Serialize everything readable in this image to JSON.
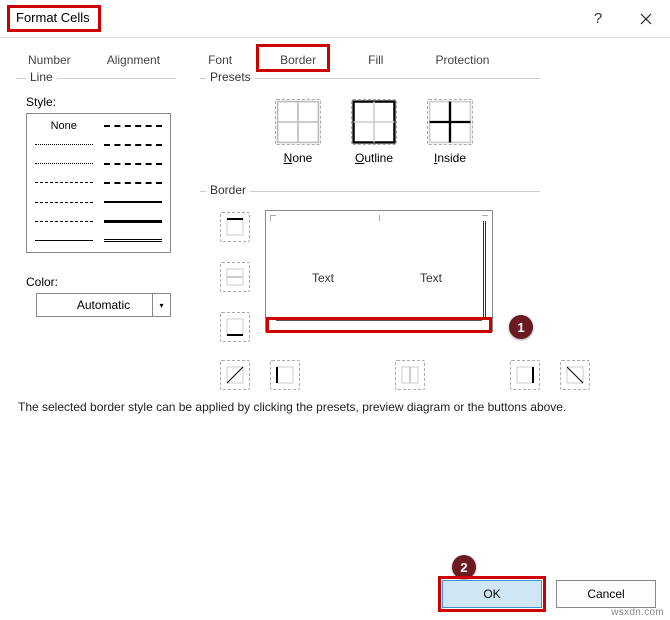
{
  "title": "Format Cells",
  "tabs": {
    "number": "Number",
    "alignment": "Alignment",
    "font": "Font",
    "border": "Border",
    "fill": "Fill",
    "protection": "Protection"
  },
  "groups": {
    "line": "Line",
    "presets": "Presets",
    "border": "Border"
  },
  "line": {
    "style_label": "Style:",
    "none": "None",
    "color_label": "Color:",
    "color_value": "Automatic"
  },
  "presets": {
    "none": "None",
    "outline": "Outline",
    "inside": "Inside"
  },
  "preview": {
    "text_left": "Text",
    "text_right": "Text"
  },
  "helper": "The selected border style can be applied by clicking the presets, preview diagram or the buttons above.",
  "footer": {
    "ok": "OK",
    "cancel": "Cancel"
  },
  "badges": {
    "one": "1",
    "two": "2"
  },
  "watermark": "wsxdn.com"
}
